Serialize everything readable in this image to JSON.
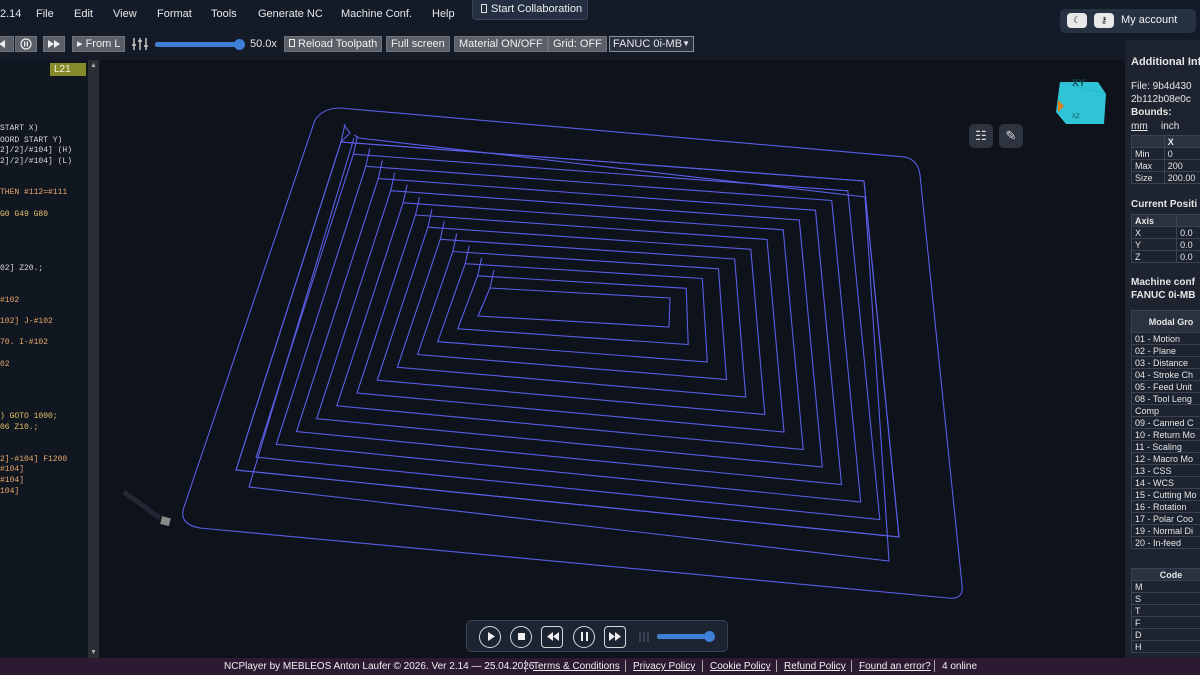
{
  "app": {
    "version_fragment": "2.14"
  },
  "menu": [
    "File",
    "Edit",
    "View",
    "Format",
    "Tools",
    "Generate NC",
    "Machine Conf.",
    "Help"
  ],
  "collab": {
    "label": "Start Collaboration"
  },
  "account": {
    "label": "My account",
    "toggle_icon": "half-moon-icon",
    "key_icon": "key-icon"
  },
  "toolbar": {
    "from_line": "▸ From L",
    "speed": "50.0x",
    "speed_fraction": 0.95,
    "reload": "Reload Toolpath",
    "fullscreen": "Full screen",
    "material": "Material ON/OFF",
    "grid": "Grid: OFF",
    "machine_select": "FANUC 0i-MB"
  },
  "editor": {
    "line_badge": "L21",
    "lines": [
      {
        "t": "START X)",
        "c": "#d8d8d8"
      },
      {
        "t": "OORD START Y)",
        "c": "#d8d8d8"
      },
      {
        "t": "2]/2]/#104] (H)",
        "c": "#d8d8d8"
      },
      {
        "t": "2]/2]/#104]  (L)",
        "c": "#d8d8d8"
      },
      {
        "t": "THEN #112=#111",
        "c": "#e8a86a"
      },
      {
        "t": "G0 G49 G80",
        "c": "#e6c06a"
      },
      {
        "t": "02] Z20.;",
        "c": "#d8d8d8"
      },
      {
        "t": "#102",
        "c": "#e8a86a"
      },
      {
        "t": "102] J-#102",
        "c": "#e8a86a"
      },
      {
        "t": "70. I-#102",
        "c": "#e8a86a"
      },
      {
        "t": "02",
        "c": "#e8a86a"
      },
      {
        "t": ")  GOTO 1000;",
        "c": "#e6c06a"
      },
      {
        "t": "06 Z10.;",
        "c": "#e6c06a"
      },
      {
        "t": "2]-#104] F1200",
        "c": "#e8a86a"
      },
      {
        "t": "#104]",
        "c": "#e8a86a"
      },
      {
        "t": "#104]",
        "c": "#e8a86a"
      },
      {
        "t": "104]",
        "c": "#e8a86a"
      }
    ]
  },
  "viewcube": {
    "top": "XY",
    "bottom": "XZ"
  },
  "right": {
    "heading": "Additional Inf",
    "file_label": "File: 9b4d430",
    "file_line2": "2b112b08e0c",
    "bounds_label": "Bounds:",
    "units": [
      "mm",
      "inch"
    ],
    "bounds_header": [
      "",
      "X"
    ],
    "bounds_rows": [
      [
        "Min",
        "0"
      ],
      [
        "Max",
        "200"
      ],
      [
        "Size",
        "200.00"
      ]
    ],
    "current_pos": "Current Positi",
    "pos_header": [
      "Axis",
      ""
    ],
    "pos_rows": [
      [
        "X",
        "0.0"
      ],
      [
        "Y",
        "0.0"
      ],
      [
        "Z",
        "0.0"
      ]
    ],
    "machine_conf": "Machine conf",
    "machine_name": "FANUC 0i-MB",
    "modal_header": "Modal Gro",
    "modal_rows": [
      "01 - Motion",
      "02 - Plane",
      "03 - Distance",
      "04 - Stroke Ch",
      "05 - Feed Unit",
      "08 - Tool Leng",
      "Comp",
      "09 - Canned C",
      "10 - Return Mo",
      "11 - Scaling",
      "12 - Macro Mo",
      "13 - CSS",
      "14 - WCS",
      "15 - Cutting Mo",
      "16 - Rotation",
      "17 - Polar Coo",
      "19 - Normal Di",
      "20 - In-feed"
    ],
    "code_header": "Code",
    "code_rows": [
      "M",
      "S",
      "T",
      "F",
      "D",
      "H"
    ]
  },
  "footer": {
    "credit": "NCPlayer by MEBLEOS Anton Laufer © 2026. Ver 2.14 — 25.04.2026",
    "links": [
      "Terms & Conditions",
      "Privacy Policy",
      "Cookie Policy",
      "Refund Policy",
      "Found an error?"
    ],
    "online": "4 online"
  },
  "playback": {
    "volume_fraction": 0.92
  },
  "colors": {
    "toolpath": "#5a5ee6",
    "accent": "#3f7fd6",
    "cube": "#2ec4d6"
  }
}
